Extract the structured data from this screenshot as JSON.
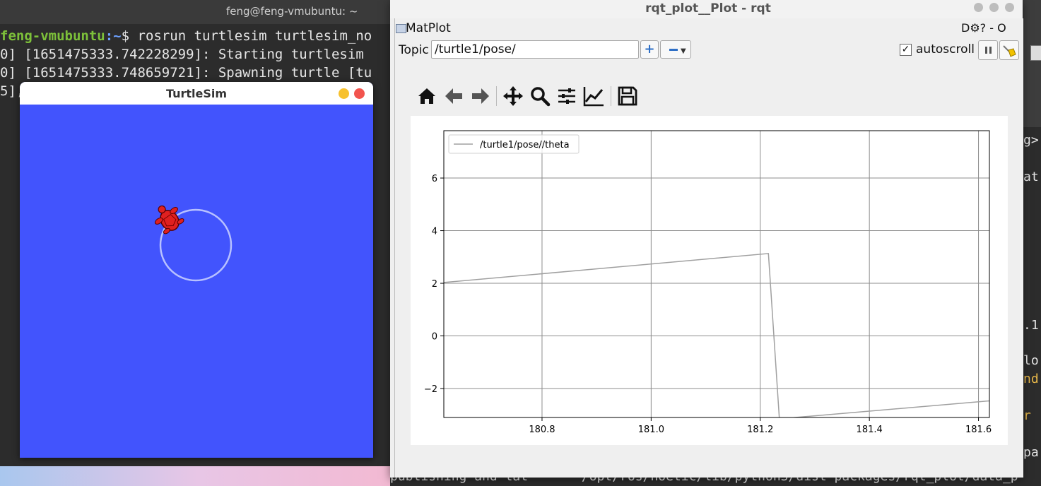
{
  "terminal": {
    "title": "feng@feng-vmubuntu: ~",
    "prompt_user": "feng-vmubuntu",
    "prompt_path": ":~",
    "prompt_symbol": "$ ",
    "command": "rosrun turtlesim turtlesim_no",
    "lines": [
      "0] [1651475333.742228299]: Starting turtlesim",
      "0] [1651475333.748659721]: Spawning turtle [tu",
      "5],"
    ]
  },
  "right_terminal": {
    "fragments": [
      "g>",
      "at",
      ".1",
      "lo",
      "nd",
      "r",
      "pa"
    ]
  },
  "bottom_terminal": {
    "text": "publishing and lat       /opt/ros/noetic/lib/python3/dist-packages/rqt_plot/data_pl"
  },
  "turtlesim": {
    "title": "TurtleSim",
    "background": "#4254fd",
    "turtle_color": "#e02020",
    "trail_color": "#b8c1ff"
  },
  "rqt": {
    "title": "rqt_plot__Plot - rqt",
    "plugin_title": "MatPlot",
    "plugin_controls": "D⚙? - O",
    "topic_label": "Topic",
    "topic_value": "/turtle1/pose/",
    "add_label": "+",
    "autoscroll_label": "autoscroll",
    "autoscroll_checked": true
  },
  "toolbar": {
    "icons": [
      "home-icon",
      "back-arrow-icon",
      "forward-arrow-icon",
      "pan-icon",
      "zoom-icon",
      "subplots-config-icon",
      "axes-edit-icon",
      "save-icon"
    ]
  },
  "chart_data": {
    "type": "line",
    "title": "",
    "xlabel": "",
    "ylabel": "",
    "xlim": [
      180.62,
      181.62
    ],
    "ylim": [
      -3.1,
      7.8
    ],
    "xticks": [
      180.8,
      181.0,
      181.2,
      181.4,
      181.6
    ],
    "xtick_labels": [
      "180.8",
      "181.0",
      "181.2",
      "181.4",
      "181.6"
    ],
    "yticks": [
      -2,
      0,
      2,
      4,
      6
    ],
    "ytick_labels": [
      "−2",
      "0",
      "2",
      "4",
      "6"
    ],
    "grid": true,
    "legend_position": "upper-left",
    "series": [
      {
        "name": "/turtle1/pose//theta",
        "color": "#a0a0a0",
        "x": [
          180.62,
          181.215,
          181.235,
          181.62
        ],
        "y": [
          2.03,
          3.13,
          -3.15,
          -2.47
        ]
      }
    ]
  }
}
